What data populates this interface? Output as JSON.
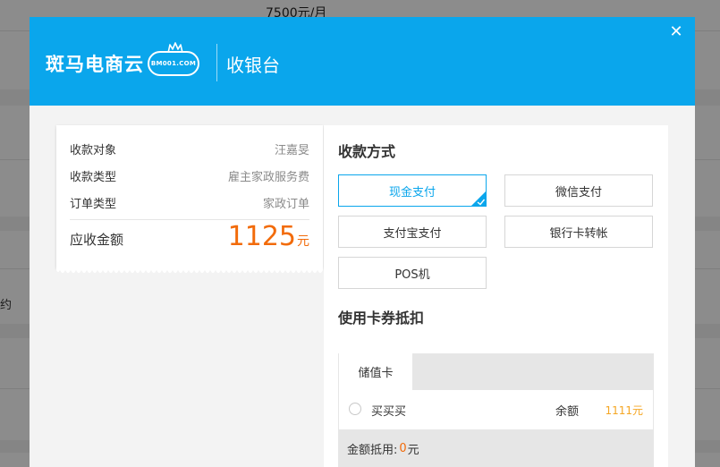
{
  "background": {
    "top_text": "7500元/月",
    "side_text": "约"
  },
  "header": {
    "logo_text": "斑马电商云",
    "logo_badge": "BM001.COM",
    "title": "收银台"
  },
  "receipt": {
    "rows": [
      {
        "label": "收款对象",
        "value": "汪嘉旻"
      },
      {
        "label": "收款类型",
        "value": "雇主家政服务费"
      },
      {
        "label": "订单类型",
        "value": "家政订单"
      }
    ],
    "total_label": "应收金额",
    "total_amount": "1125",
    "total_unit": "元"
  },
  "payment": {
    "title": "收款方式",
    "methods": [
      {
        "label": "现金支付",
        "selected": true
      },
      {
        "label": "微信支付",
        "selected": false
      },
      {
        "label": "支付宝支付",
        "selected": false
      },
      {
        "label": "银行卡转帐",
        "selected": false
      },
      {
        "label": "POS机",
        "selected": false
      }
    ]
  },
  "cards": {
    "title": "使用卡券抵扣",
    "tab_label": "储值卡",
    "item_name": "买买买",
    "balance_label": "余额",
    "balance_value": "1111元",
    "deduct_label": "金额抵用:",
    "deduct_value": "0",
    "deduct_unit": "元"
  },
  "colors": {
    "brand_blue": "#0aa6ec",
    "accent_orange": "#f26b0a",
    "balance_yellow": "#f5a623"
  }
}
